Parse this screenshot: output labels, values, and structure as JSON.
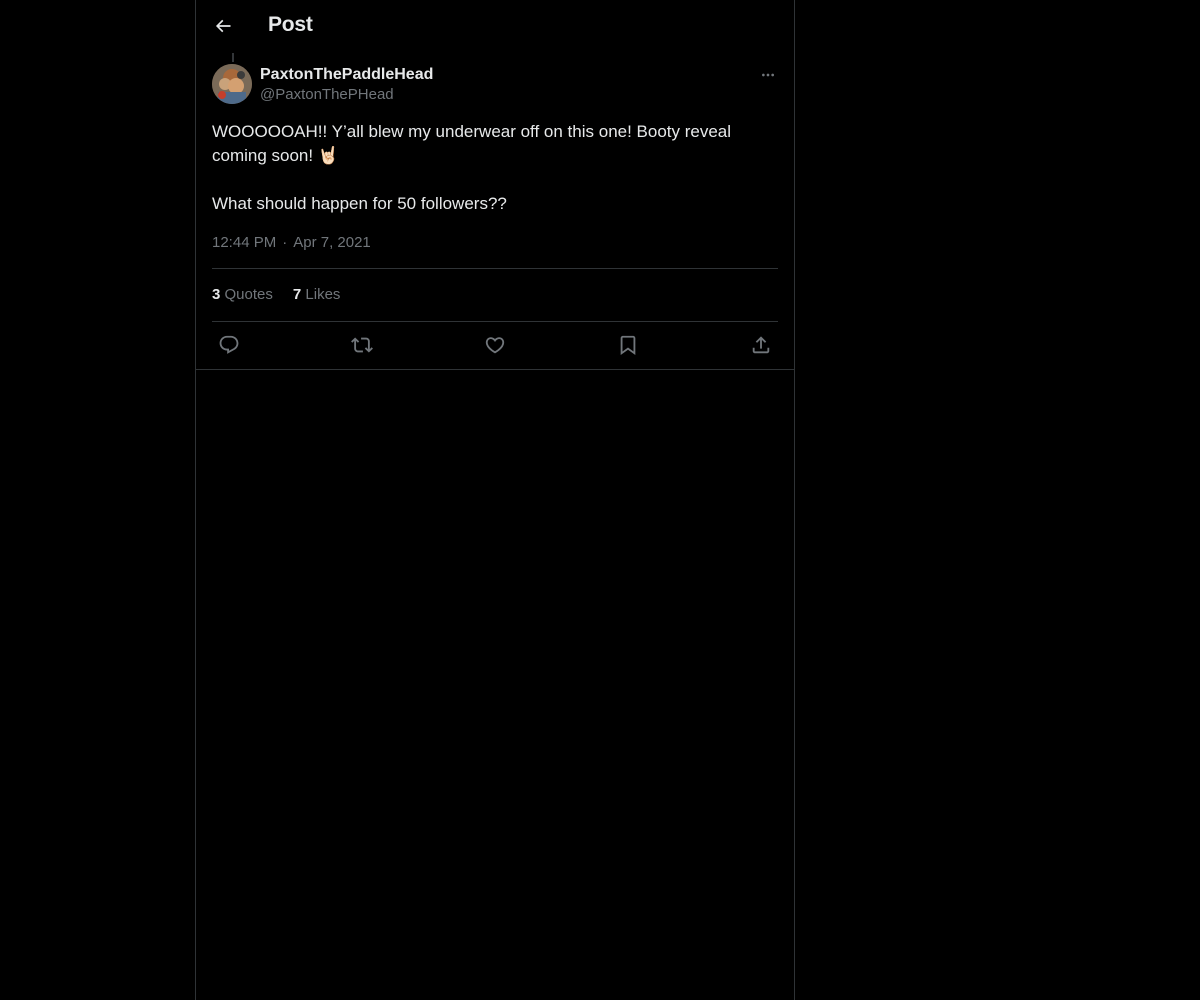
{
  "header": {
    "title": "Post",
    "back_icon": "arrow-left-icon"
  },
  "tweet": {
    "display_name": "PaxtonThePaddleHead",
    "handle": "@PaxtonThePHead",
    "text": "WOOOOOAH!! Y’all blew my underwear off on this one! Booty reveal coming soon! 🤘🏻\n\nWhat should happen for 50 followers??",
    "time": "12:44 PM",
    "separator": "·",
    "date": "Apr 7, 2021"
  },
  "stats": {
    "quotes_count": "3",
    "quotes_label": "Quotes",
    "likes_count": "7",
    "likes_label": "Likes"
  },
  "actions": [
    "reply-icon",
    "retweet-icon",
    "like-icon",
    "bookmark-icon",
    "share-icon"
  ],
  "colors": {
    "background": "#000000",
    "text_primary": "#e7e9ea",
    "text_secondary": "#71767b",
    "border": "#2f3336"
  }
}
